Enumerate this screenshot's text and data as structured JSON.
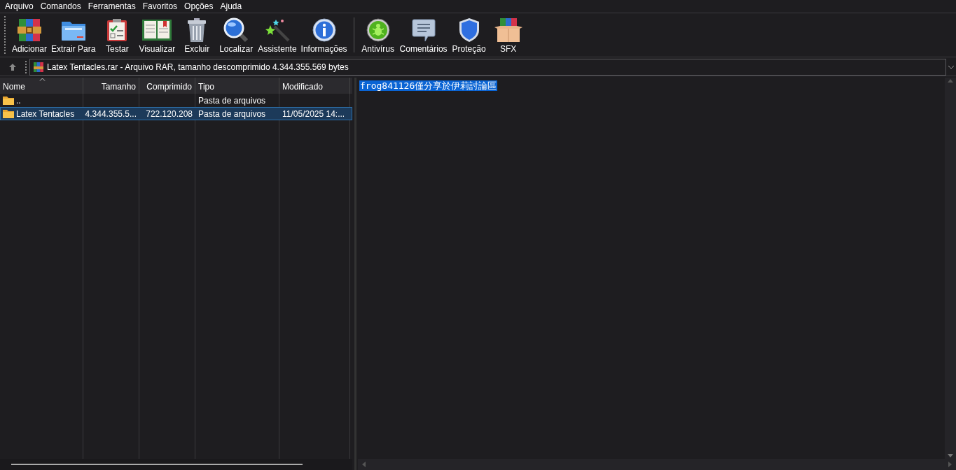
{
  "menu": [
    "Arquivo",
    "Comandos",
    "Ferramentas",
    "Favoritos",
    "Opções",
    "Ajuda"
  ],
  "toolbar_groups": [
    {
      "buttons": [
        "Adicionar",
        "Extrair Para",
        "Testar",
        "Visualizar",
        "Excluir",
        "Localizar",
        "Assistente",
        "Informações"
      ]
    },
    {
      "buttons": [
        "Antivírus",
        "Comentários",
        "Proteção",
        "SFX"
      ]
    }
  ],
  "path": "Latex Tentacles.rar - Arquivo RAR, tamanho descomprimido 4.344.355.569 bytes",
  "columns": [
    {
      "label": "Nome",
      "sorted": true
    },
    {
      "label": "Tamanho",
      "sorted": false
    },
    {
      "label": "Comprimido",
      "sorted": false
    },
    {
      "label": "Tipo",
      "sorted": false
    },
    {
      "label": "Modificado",
      "sorted": false
    }
  ],
  "rows": [
    {
      "cells": [
        "..",
        "",
        "",
        "Pasta de arquivos",
        ""
      ],
      "selected": false
    },
    {
      "cells": [
        "Latex Tentacles",
        "4.344.355.5...",
        "722.120.208",
        "Pasta de arquivos",
        "11/05/2025 14:..."
      ],
      "selected": true
    }
  ],
  "comment": {
    "text": "frog841126僅分享於伊莉討論區",
    "selected": true
  }
}
